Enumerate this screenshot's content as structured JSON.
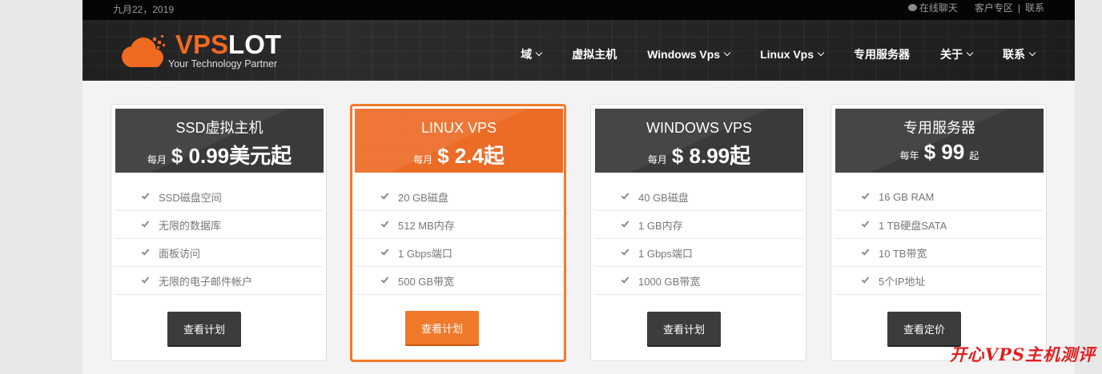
{
  "topbar": {
    "date": "九月22，2019",
    "chat": "在线聊天",
    "customer_area": "客户专区",
    "separator": "|",
    "contact": "联系"
  },
  "logo": {
    "brand_vps": "VPS",
    "brand_lot": "LOT",
    "tagline": "Your Technology Partner"
  },
  "nav": [
    {
      "label": "域",
      "dropdown": true
    },
    {
      "label": "虚拟主机",
      "dropdown": false
    },
    {
      "label": "Windows Vps",
      "dropdown": true
    },
    {
      "label": "Linux Vps",
      "dropdown": true
    },
    {
      "label": "专用服务器",
      "dropdown": false
    },
    {
      "label": "关于",
      "dropdown": true
    },
    {
      "label": "联系",
      "dropdown": true
    }
  ],
  "cards": [
    {
      "title": "SSD虚拟主机",
      "period": "每月",
      "price": "$ 0.99美元起",
      "suffix": "",
      "features": [
        "SSD磁盘空间",
        "无限的数据库",
        "面板访问",
        "无限的电子邮件帐户"
      ],
      "button": "查看计划"
    },
    {
      "title": "LINUX VPS",
      "period": "每月",
      "price": "$ 2.4起",
      "suffix": "",
      "features": [
        "20 GB磁盘",
        "512 MB内存",
        "1 Gbps端口",
        "500 GB带宽"
      ],
      "button": "查看计划"
    },
    {
      "title": "WINDOWS VPS",
      "period": "每月",
      "price": "$ 8.99起",
      "suffix": "",
      "features": [
        "40 GB磁盘",
        "1 GB内存",
        "1 Gbps端口",
        "1000 GB带宽"
      ],
      "button": "查看计划"
    },
    {
      "title": "专用服务器",
      "period": "每年",
      "price": "$ 99",
      "suffix": "起",
      "features": [
        "16 GB RAM",
        "1 TB硬盘SATA",
        "10 TB带宽",
        "5个IP地址"
      ],
      "button": "查看定价"
    }
  ],
  "watermark": "开心VPS主机测评",
  "colors": {
    "accent": "#f06a21",
    "dark": "#3a3a3a"
  }
}
